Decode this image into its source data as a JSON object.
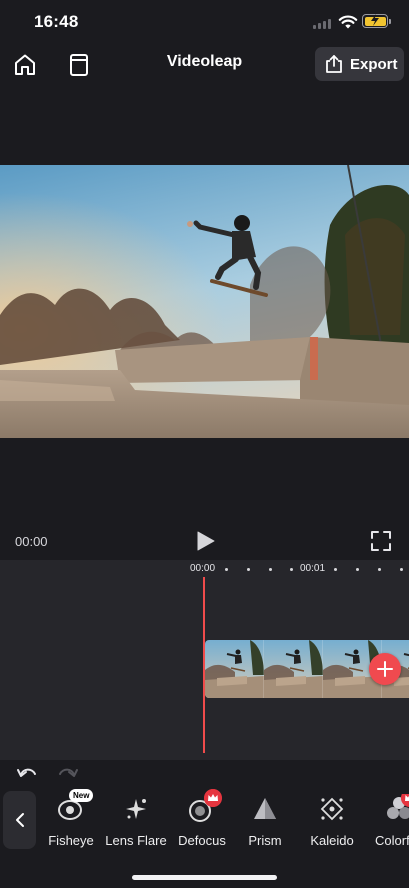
{
  "status_bar": {
    "time": "16:48"
  },
  "header": {
    "title": "Videoleap",
    "export_label": "Export"
  },
  "player": {
    "current_time": "00:00"
  },
  "timeline": {
    "ruler_labels": [
      "00:00",
      "00:01"
    ]
  },
  "toolbar": {
    "tools": [
      {
        "label": "Fisheye",
        "icon": "fisheye-icon",
        "badge": "New"
      },
      {
        "label": "Lens Flare",
        "icon": "lens-flare-icon"
      },
      {
        "label": "Defocus",
        "icon": "defocus-icon",
        "badge_icon": "crown-icon"
      },
      {
        "label": "Prism",
        "icon": "prism-icon"
      },
      {
        "label": "Kaleido",
        "icon": "kaleido-icon"
      },
      {
        "label": "Colorful",
        "icon": "colorful-icon",
        "badge_icon": "crown-icon"
      }
    ]
  },
  "colors": {
    "accent": "#ef4b4b",
    "background": "#1b1b1f",
    "timeline": "#26262b",
    "premium": "#e5353f"
  }
}
